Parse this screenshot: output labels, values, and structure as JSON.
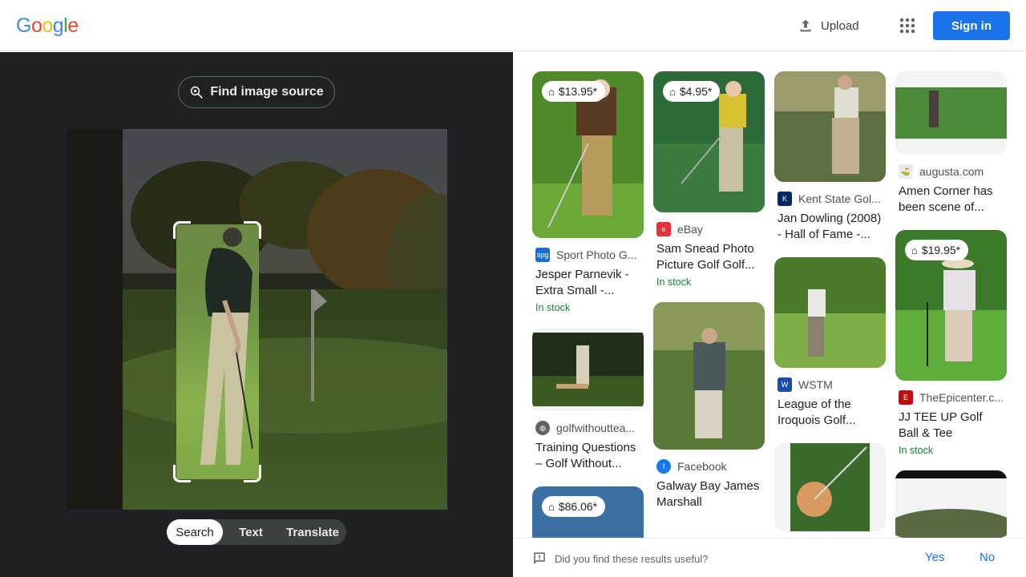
{
  "header": {
    "logo_letters": [
      "G",
      "o",
      "o",
      "g",
      "l",
      "e"
    ],
    "logo_colors": [
      "#4285f4",
      "#ea4335",
      "#fbbc05",
      "#4285f4",
      "#34a853",
      "#ea4335"
    ],
    "upload_label": "Upload",
    "apps_icon": "apps-grid-icon",
    "signin_label": "Sign in"
  },
  "lens": {
    "find_source_label": "Find image source",
    "modes": [
      "Search",
      "Text",
      "Translate"
    ],
    "active_mode": "Search"
  },
  "results": {
    "col1": [
      {
        "price": "$13.95*",
        "source": "Sport Photo G...",
        "title": "Jesper Parnevik - Extra Small -...",
        "stock": "In stock"
      },
      {
        "price": "",
        "source": "golfwithoutteа...",
        "title": "Training Questions – Golf Without...",
        "stock": ""
      },
      {
        "price": "$86.06*",
        "source": "",
        "title": "",
        "stock": ""
      }
    ],
    "col2": [
      {
        "price": "$4.95*",
        "source": "eBay",
        "title": "Sam Snead Photo Picture Golf Golf...",
        "stock": "In stock"
      },
      {
        "price": "",
        "source": "Facebook",
        "title": "Galway Bay James Marshall Memoria...",
        "stock": ""
      }
    ],
    "col3": [
      {
        "price": "",
        "source": "Kent State Gol...",
        "title": "Jan Dowling (2008) - Hall of Fame -...",
        "stock": ""
      },
      {
        "price": "",
        "source": "WSTM",
        "title": "League of the Iroquois Golf...",
        "stock": ""
      }
    ],
    "col4": [
      {
        "price": "",
        "source": "augusta.com",
        "title": "Amen Corner has been scene of...",
        "stock": ""
      },
      {
        "price": "$19.95*",
        "source": "TheEpicenter.c...",
        "title": "JJ TEE UP Golf Ball & Tee Setting/Pick...",
        "stock": "In stock"
      }
    ]
  },
  "feedback": {
    "question": "Did you find these results useful?",
    "yes": "Yes",
    "no": "No"
  }
}
